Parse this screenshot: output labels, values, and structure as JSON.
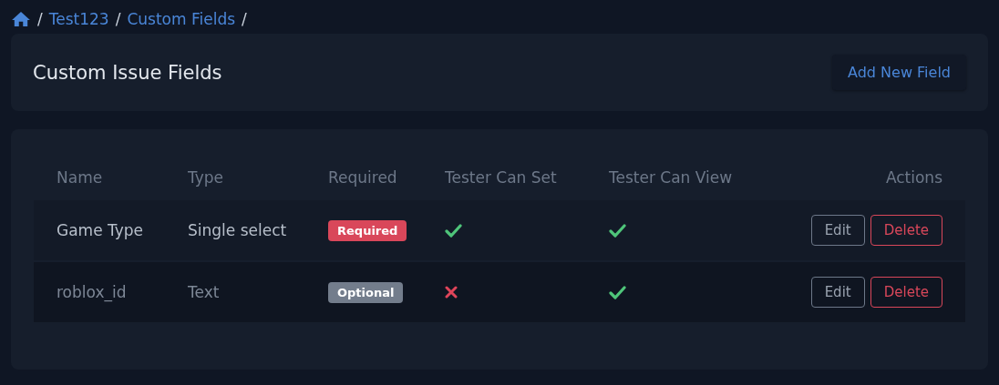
{
  "breadcrumb": {
    "items": [
      {
        "separator": "/",
        "label": "Test123"
      },
      {
        "separator": "/",
        "label": "Custom Fields"
      }
    ],
    "trailing_separator": "/"
  },
  "header": {
    "title": "Custom Issue Fields",
    "add_button": "Add New Field"
  },
  "table": {
    "columns": [
      "Name",
      "Type",
      "Required",
      "Tester Can Set",
      "Tester Can View",
      "Actions"
    ],
    "rows": [
      {
        "name": "Game Type",
        "type": "Single select",
        "required": true,
        "badge": "Required",
        "tester_can_set": true,
        "tester_can_view": true,
        "edit": "Edit",
        "delete": "Delete"
      },
      {
        "name": "roblox_id",
        "type": "Text",
        "required": false,
        "badge": "Optional",
        "tester_can_set": false,
        "tester_can_view": true,
        "edit": "Edit",
        "delete": "Delete"
      }
    ]
  }
}
